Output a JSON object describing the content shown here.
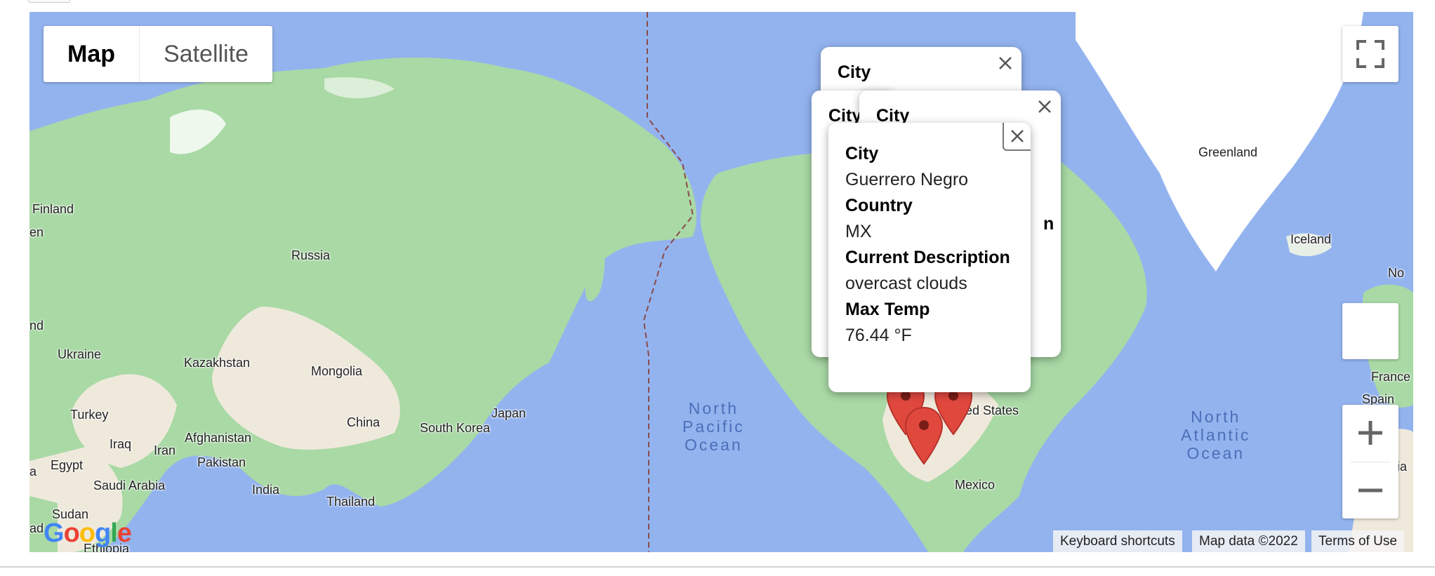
{
  "map_type": {
    "map_label": "Map",
    "satellite_label": "Satellite",
    "selected": "Map"
  },
  "places": {
    "finland": "Finland",
    "russia": "Russia",
    "ukraine": "Ukraine",
    "kazakhstan": "Kazakhstan",
    "mongolia": "Mongolia",
    "turkey": "Turkey",
    "iraq": "Iraq",
    "iran": "Iran",
    "afghanistan": "Afghanistan",
    "pakistan": "Pakistan",
    "china": "China",
    "south_korea": "South Korea",
    "japan": "Japan",
    "egypt": "Egypt",
    "saudi_arabia": "Saudi Arabia",
    "india": "India",
    "thailand": "Thailand",
    "sudan": "Sudan",
    "ethiopia": "Ethiopia",
    "greenland": "Greenland",
    "iceland": "Iceland",
    "france": "France",
    "spain": "Spain",
    "united_states": "United States",
    "mexico": "Mexico",
    "edge_en": "en",
    "edge_nd": "nd",
    "edge_a": "a",
    "edge_ad": "ad",
    "edge_no": "No",
    "edge_ria": "ria",
    "north_pacific_ocean": "North\nPacific\nOcean",
    "north_atlantic_ocean": "North\nAtlantic\nOcean"
  },
  "info_windows": {
    "back_1_heading": "City",
    "back_2_heading": "City",
    "back_3_heading": "City",
    "back_3_fragment": "n",
    "front": {
      "city_label": "City",
      "city_value": "Guerrero Negro",
      "country_label": "Country",
      "country_value": "MX",
      "description_label": "Current Description",
      "description_value": "overcast clouds",
      "max_temp_label": "Max Temp",
      "max_temp_value": "76.44 °F"
    }
  },
  "markers": {
    "count_visible": 3,
    "color": "#e0483e"
  },
  "attribution": {
    "keyboard_shortcuts": "Keyboard shortcuts",
    "map_data": "Map data ©2022",
    "terms": "Terms of Use"
  },
  "logo": "Google",
  "icons": {
    "fullscreen": "fullscreen-icon",
    "zoom_in": "plus-icon",
    "zoom_out": "minus-icon",
    "close": "close-icon",
    "marker": "map-pin-icon"
  },
  "colors": {
    "water": "#93b3ef",
    "land": "#a9d9a5",
    "desert": "#efe9dc",
    "ice": "#ffffff",
    "accent_marker": "#e0483e"
  }
}
